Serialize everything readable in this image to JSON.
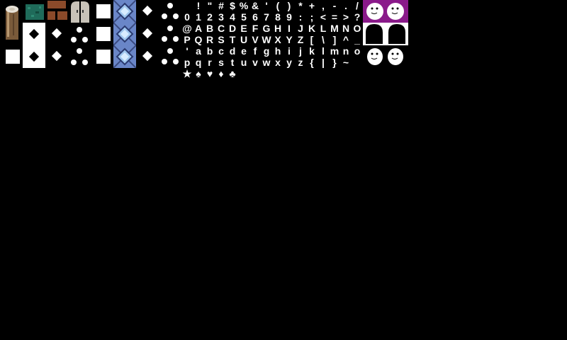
{
  "atlas": {
    "glyph_rows": [
      [
        " ",
        "!",
        "\"",
        "#",
        "$",
        "%",
        "&",
        "'",
        "(",
        ")",
        "*",
        "+",
        ",",
        "-",
        ".",
        "/"
      ],
      [
        "0",
        "1",
        "2",
        "3",
        "4",
        "5",
        "6",
        "7",
        "8",
        "9",
        ":",
        ";",
        "<",
        "=",
        ">",
        "?"
      ],
      [
        "@",
        "A",
        "B",
        "C",
        "D",
        "E",
        "F",
        "G",
        "H",
        "I",
        "J",
        "K",
        "L",
        "M",
        "N",
        "O"
      ],
      [
        "P",
        "Q",
        "R",
        "S",
        "T",
        "U",
        "V",
        "W",
        "X",
        "Y",
        "Z",
        "[",
        "\\",
        "]",
        "^",
        "_"
      ],
      [
        "'",
        "a",
        "b",
        "c",
        "d",
        "e",
        "f",
        "g",
        "h",
        "i",
        "j",
        "k",
        "l",
        "m",
        "n",
        "o"
      ],
      [
        "p",
        "q",
        "r",
        "s",
        "t",
        "u",
        "v",
        "w",
        "x",
        "y",
        "z",
        "{",
        "|",
        "}",
        "~",
        " "
      ]
    ],
    "symbols": [
      "★",
      "♠",
      "♥",
      "♦",
      "♣"
    ]
  },
  "colors": {
    "background": "#000000",
    "ghost_bg": "#8a1a8a",
    "blue_tile": "#6a86c8"
  }
}
